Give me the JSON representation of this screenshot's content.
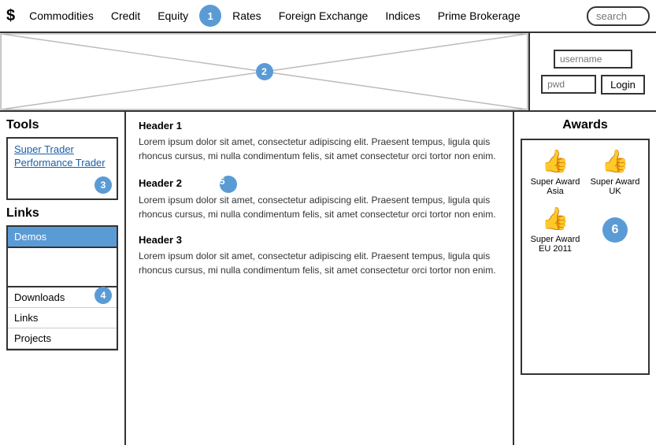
{
  "navbar": {
    "dollar_icon": "$",
    "items": [
      {
        "label": "Commodities",
        "id": "commodities",
        "active": false
      },
      {
        "label": "Credit",
        "id": "credit",
        "active": false
      },
      {
        "label": "Equity",
        "id": "equity",
        "active": false
      },
      {
        "label": "badge_1",
        "id": "badge1",
        "active": true,
        "badge": "1"
      },
      {
        "label": "Rates",
        "id": "rates",
        "active": false
      },
      {
        "label": "Foreign Exchange",
        "id": "fx",
        "active": false
      },
      {
        "label": "Indices",
        "id": "indices",
        "active": false
      },
      {
        "label": "Prime Brokerage",
        "id": "prime",
        "active": false
      }
    ],
    "search_placeholder": "search"
  },
  "hero": {
    "badge": "2",
    "username_placeholder": "username",
    "password_placeholder": "pwd",
    "login_label": "Login"
  },
  "sidebar": {
    "tools_title": "Tools",
    "tools": [
      {
        "label": "Super Trader"
      },
      {
        "label": "Performance Trader"
      }
    ],
    "tools_badge": "3",
    "links_title": "Links",
    "links": [
      {
        "label": "Demos",
        "active": true
      }
    ],
    "links_bottom": [
      {
        "label": "Downloads"
      },
      {
        "label": "Links"
      },
      {
        "label": "Projects"
      }
    ],
    "links_badge": "4"
  },
  "content": {
    "sections": [
      {
        "header": "Header 1",
        "body": "Lorem ipsum dolor sit amet, consectetur adipiscing elit. Praesent tempus, ligula quis rhoncus cursus, mi nulla condimentum felis, sit amet consectetur orci tortor non enim."
      },
      {
        "header": "Header 2",
        "body": "Lorem ipsum dolor sit amet, consectetur adipiscing elit. Praesent tempus, ligula quis rhoncus cursus, mi nulla condimentum felis, sit amet consectetur orci tortor non enim.",
        "badge": "5"
      },
      {
        "header": "Header 3",
        "body": "Lorem ipsum dolor sit amet, consectetur adipiscing elit. Praesent tempus, ligula quis rhoncus cursus, mi nulla condimentum felis, sit amet consectetur orci tortor non enim."
      }
    ]
  },
  "awards": {
    "title": "Awards",
    "items": [
      {
        "label": "Super Award Asia"
      },
      {
        "label": "Super Award UK"
      },
      {
        "label": "Super Award EU 2011"
      },
      {
        "badge": "6"
      }
    ]
  }
}
